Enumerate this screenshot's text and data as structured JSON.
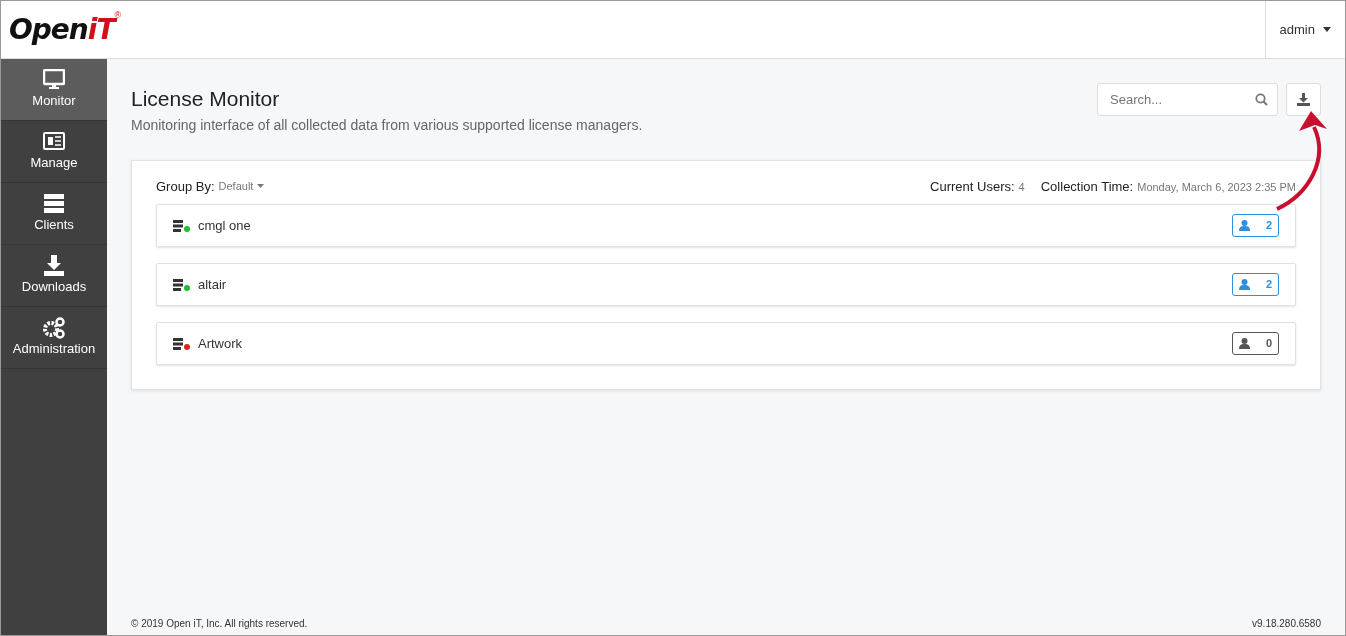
{
  "logo": {
    "word": "Open",
    "accent": "iT",
    "mark": "®"
  },
  "user_menu": {
    "label": "admin"
  },
  "sidebar": {
    "items": [
      {
        "label": "Monitor",
        "kind": "monitor",
        "selected": true
      },
      {
        "label": "Manage",
        "kind": "manage",
        "selected": false
      },
      {
        "label": "Clients",
        "kind": "clients",
        "selected": false
      },
      {
        "label": "Downloads",
        "kind": "downloads",
        "selected": false
      },
      {
        "label": "Administration",
        "kind": "admin",
        "selected": false
      }
    ]
  },
  "page": {
    "title": "License Monitor",
    "subtitle": "Monitoring interface of all collected data from various supported license managers."
  },
  "search": {
    "placeholder": "Search..."
  },
  "panel": {
    "group_by_label": "Group By:",
    "group_by_value": "Default",
    "current_users_label": "Current Users:",
    "current_users_value": "4",
    "collection_time_label": "Collection Time:",
    "collection_time_value": "Monday, March 6, 2023 2:35 PM"
  },
  "servers": [
    {
      "name": "cmgl one",
      "color": "#22bb33",
      "users": "2",
      "active": true
    },
    {
      "name": "altair",
      "color": "#22bb33",
      "users": "2",
      "active": true
    },
    {
      "name": "Artwork",
      "color": "#dd2222",
      "users": "0",
      "active": false
    }
  ],
  "footer": {
    "copyright": "© 2019 Open iT, Inc. All rights reserved.",
    "version": "v9.18.280.6580"
  }
}
